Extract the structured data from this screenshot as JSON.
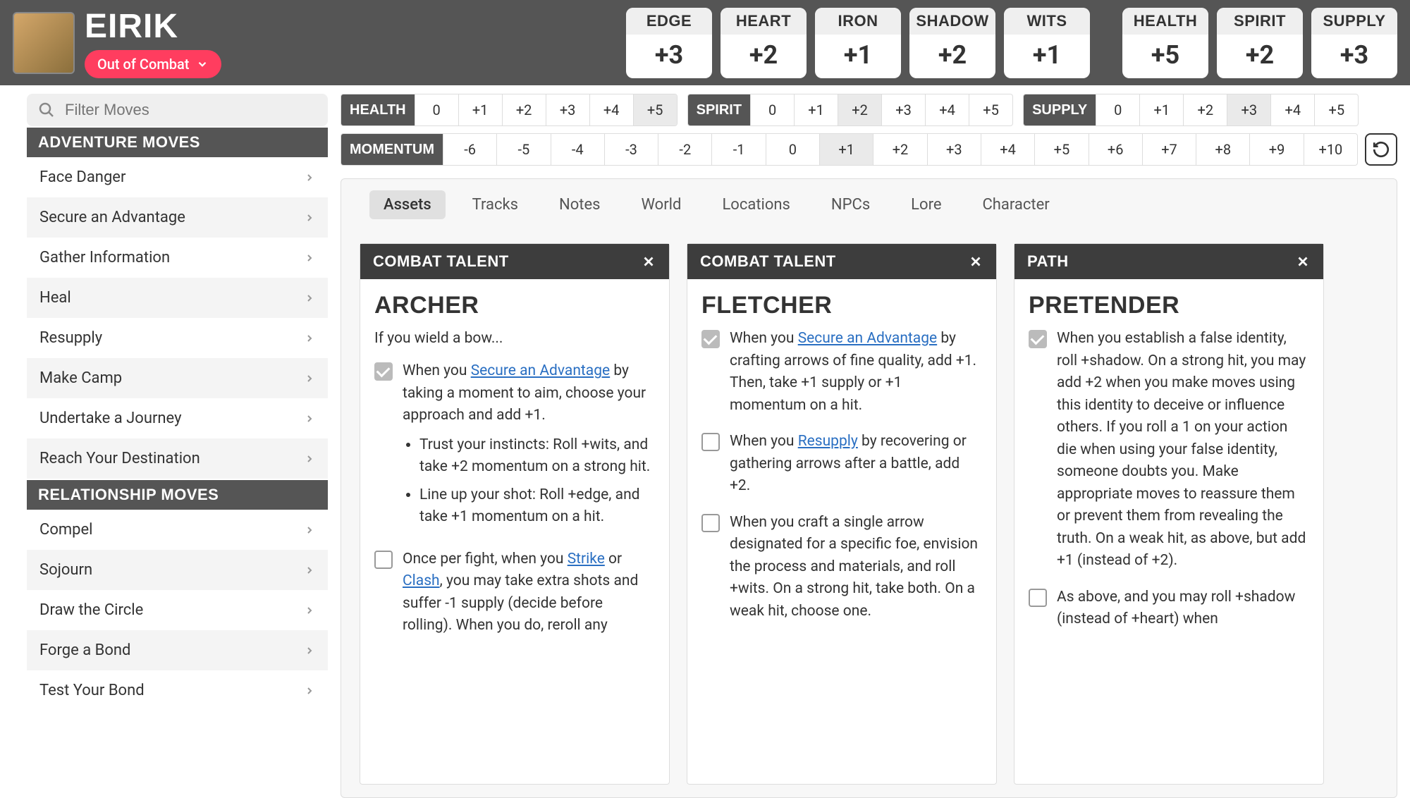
{
  "header": {
    "name": "EIRIK",
    "status": "Out of Combat",
    "stats": [
      {
        "label": "Edge",
        "value": "+3"
      },
      {
        "label": "Heart",
        "value": "+2"
      },
      {
        "label": "Iron",
        "value": "+1"
      },
      {
        "label": "Shadow",
        "value": "+2"
      },
      {
        "label": "Wits",
        "value": "+1"
      }
    ],
    "meters": [
      {
        "label": "Health",
        "value": "+5"
      },
      {
        "label": "Spirit",
        "value": "+2"
      },
      {
        "label": "Supply",
        "value": "+3"
      }
    ]
  },
  "sidebar": {
    "search_placeholder": "Filter Moves",
    "sections": [
      {
        "title": "Adventure Moves",
        "moves": [
          "Face Danger",
          "Secure an Advantage",
          "Gather Information",
          "Heal",
          "Resupply",
          "Make Camp",
          "Undertake a Journey",
          "Reach Your Destination"
        ]
      },
      {
        "title": "Relationship Moves",
        "moves": [
          "Compel",
          "Sojourn",
          "Draw the Circle",
          "Forge a Bond",
          "Test Your Bond"
        ]
      }
    ]
  },
  "tracks": {
    "health": {
      "label": "Health",
      "cells": [
        "0",
        "+1",
        "+2",
        "+3",
        "+4",
        "+5"
      ],
      "sel": 5
    },
    "spirit": {
      "label": "Spirit",
      "cells": [
        "0",
        "+1",
        "+2",
        "+3",
        "+4",
        "+5"
      ],
      "sel": 2
    },
    "supply": {
      "label": "Supply",
      "cells": [
        "0",
        "+1",
        "+2",
        "+3",
        "+4",
        "+5"
      ],
      "sel": 3
    },
    "momentum": {
      "label": "Momentum",
      "cells": [
        "-6",
        "-5",
        "-4",
        "-3",
        "-2",
        "-1",
        "0",
        "+1",
        "+2",
        "+3",
        "+4",
        "+5",
        "+6",
        "+7",
        "+8",
        "+9",
        "+10"
      ],
      "sel": 7
    }
  },
  "tabs": [
    "Assets",
    "Tracks",
    "Notes",
    "World",
    "Locations",
    "NPCs",
    "Lore",
    "Character"
  ],
  "active_tab": 0,
  "cards": [
    {
      "type": "Combat Talent",
      "title": "ARCHER",
      "intro": "If you wield a bow...",
      "abilities": [
        {
          "checked": true,
          "html": "When you <a class='lnk'>Secure an Advantage</a> by taking a moment to aim, choose your approach and add +1.<ul><li>Trust your instincts: Roll +wits, and take +2 momentum on a strong hit.</li><li>Line up your shot: Roll +edge, and take +1 momentum on a hit.</li></ul>"
        },
        {
          "checked": false,
          "html": "Once per fight, when you <a class='lnk'>Strike</a> or <a class='lnk'>Clash</a>, you may take extra shots and suffer -1 supply (decide before rolling). When you do, reroll any"
        }
      ]
    },
    {
      "type": "Combat Talent",
      "title": "FLETCHER",
      "abilities": [
        {
          "checked": true,
          "html": "When you <a class='lnk'>Secure an Advantage</a> by crafting arrows of fine quality, add +1. Then, take +1 supply or +1 momentum on a hit."
        },
        {
          "checked": false,
          "html": "When you <a class='lnk'>Resupply</a> by recovering or gathering arrows after a battle, add +2."
        },
        {
          "checked": false,
          "html": "When you craft a single arrow designated for a specific foe, envision the process and materials, and roll +wits. On a strong hit, take both. On a weak hit, choose one."
        }
      ]
    },
    {
      "type": "Path",
      "title": "PRETENDER",
      "abilities": [
        {
          "checked": true,
          "html": "When you establish a false identity, roll +shadow. On a strong hit, you may add +2 when you make moves using this identity to deceive or influence others. If you roll a 1 on your action die when using your false identity, someone doubts you. Make appropriate moves to reassure them or prevent them from revealing the truth. On a weak hit, as above, but add +1 (instead of +2)."
        },
        {
          "checked": false,
          "html": "As above, and you may roll +shadow (instead of +heart) when"
        }
      ]
    }
  ]
}
